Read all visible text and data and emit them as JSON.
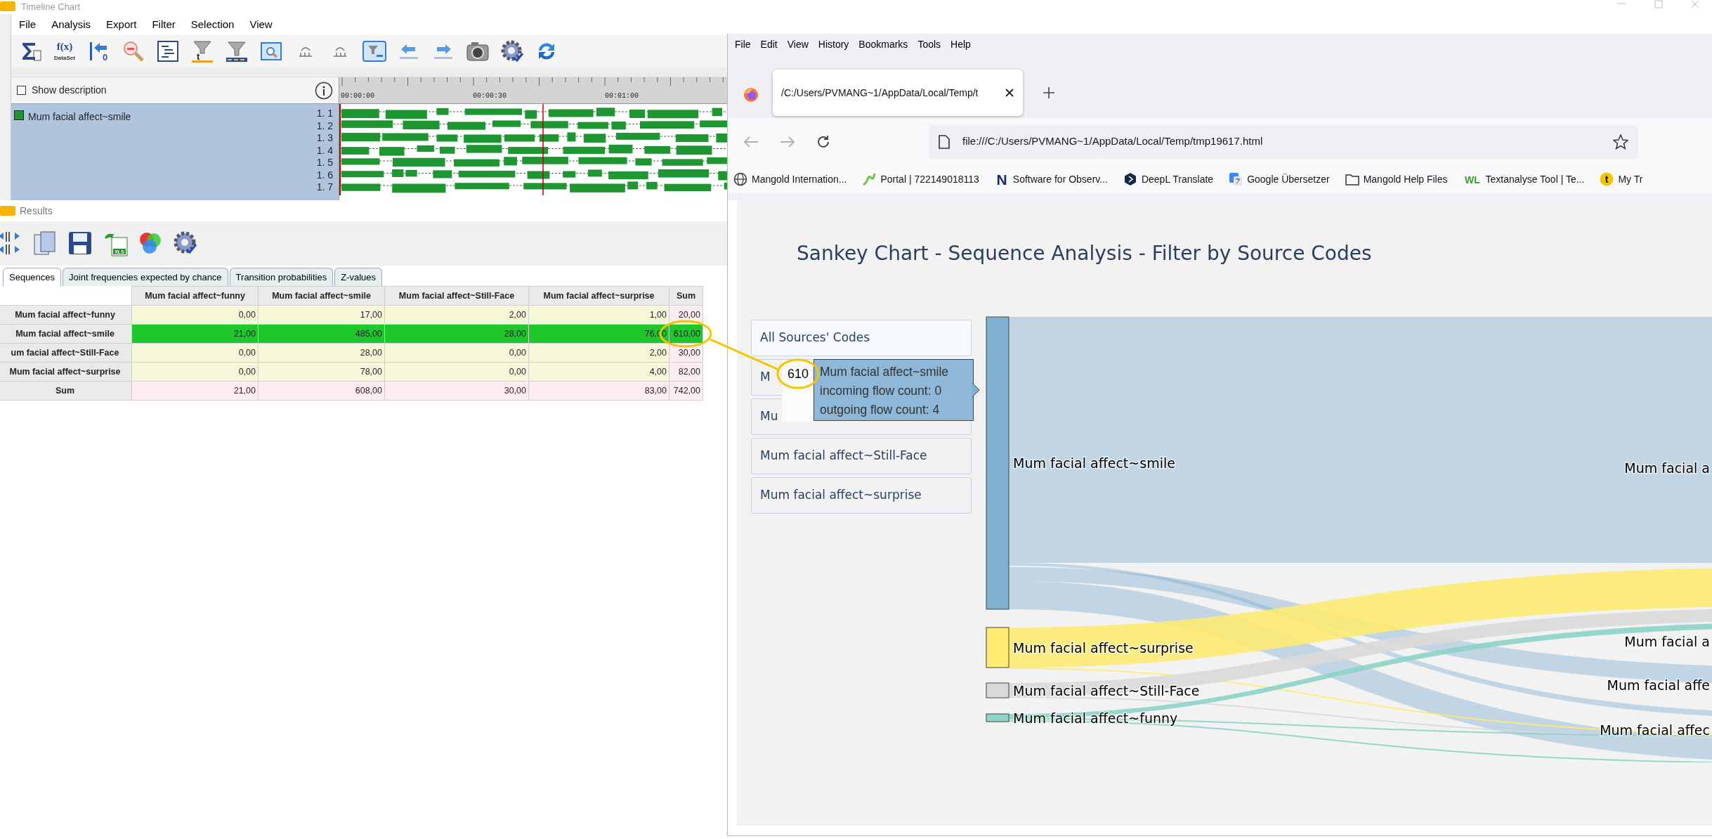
{
  "timeline_window": {
    "title": "Timeline Chart",
    "menu": [
      "File",
      "Analysis",
      "Export",
      "Filter",
      "Selection",
      "View"
    ],
    "toolbar": [
      {
        "kind": "sigma"
      },
      {
        "kind": "fx",
        "text": "f(x)",
        "subtext": "DataSet"
      },
      {
        "kind": "goto_start",
        "text": "0"
      },
      {
        "kind": "zoom_out"
      },
      {
        "kind": "outline"
      },
      {
        "kind": "filter_t",
        "text": "t"
      },
      {
        "kind": "filter_bar"
      },
      {
        "kind": "search"
      },
      {
        "kind": "step_back"
      },
      {
        "kind": "step_forward"
      },
      {
        "kind": "filter_window"
      },
      {
        "kind": "arrow_left"
      },
      {
        "kind": "arrow_right"
      },
      {
        "kind": "camera"
      },
      {
        "kind": "gear"
      },
      {
        "kind": "refresh"
      }
    ],
    "show_description": {
      "label": "Show description",
      "checked": false
    },
    "code": {
      "label": "Mum facial affect~smile",
      "color": "#1e9632"
    },
    "rows": [
      "1. 1",
      "1. 2",
      "1. 3",
      "1. 4",
      "1. 5",
      "1. 6",
      "1. 7"
    ],
    "time_labels": [
      "00:00:00",
      "00:00:30",
      "00:01:00"
    ]
  },
  "results_window": {
    "title": "Results",
    "toolbar": [
      {
        "kind": "transpose"
      },
      {
        "kind": "copy"
      },
      {
        "kind": "save"
      },
      {
        "kind": "excel",
        "text": "XLS"
      },
      {
        "kind": "circles"
      },
      {
        "kind": "settings"
      }
    ],
    "tabs": [
      {
        "label": "Sequences",
        "selected": true
      },
      {
        "label": "Joint frequencies expected by chance",
        "selected": false
      },
      {
        "label": "Transition probabilities",
        "selected": false
      },
      {
        "label": "Z-values",
        "selected": false
      }
    ],
    "table": {
      "columns": [
        "Mum facial affect~funny",
        "Mum facial affect~smile",
        "Mum facial affect~Still-Face",
        "Mum facial affect~surprise",
        "Sum"
      ],
      "rows": [
        {
          "label": "Mum facial affect~funny",
          "kind": "code",
          "selected": false,
          "cells": [
            "0,00",
            "17,00",
            "2,00",
            "1,00",
            "20,00"
          ]
        },
        {
          "label": "Mum facial affect~smile",
          "kind": "code",
          "selected": true,
          "cells": [
            "21,00",
            "485,00",
            "28,00",
            "76,00",
            "610,00"
          ]
        },
        {
          "label": "um facial affect~Still-Face",
          "kind": "code",
          "selected": false,
          "cells": [
            "0,00",
            "28,00",
            "0,00",
            "2,00",
            "30,00"
          ]
        },
        {
          "label": "Mum facial affect~surprise",
          "kind": "code",
          "selected": false,
          "cells": [
            "0,00",
            "78,00",
            "0,00",
            "4,00",
            "82,00"
          ]
        },
        {
          "label": "Sum",
          "kind": "sum",
          "selected": false,
          "cells": [
            "21,00",
            "608,00",
            "30,00",
            "83,00",
            "742,00"
          ]
        }
      ]
    }
  },
  "browser": {
    "menu": [
      "File",
      "Edit",
      "View",
      "History",
      "Bookmarks",
      "Tools",
      "Help"
    ],
    "tab": {
      "title": "/C:/Users/PVMANG~1/AppData/Local/Temp/t"
    },
    "back": {
      "disabled": true
    },
    "forward": {
      "disabled": true
    },
    "url": "file:///C:/Users/PVMANG~1/AppData/Local/Temp/tmp19617.html",
    "bookmarks": [
      {
        "kind": "globe",
        "label": "Mangold Internation..."
      },
      {
        "kind": "portal",
        "label": "Portal | 722149018113"
      },
      {
        "kind": "letter",
        "icon_text": "N",
        "label": "Software for Observ..."
      },
      {
        "kind": "deepl",
        "label": "DeepL Translate"
      },
      {
        "kind": "translate",
        "label": "Google Übersetzer"
      },
      {
        "kind": "folder",
        "label": "Mangold Help Files"
      },
      {
        "kind": "wl",
        "icon_text": "WL",
        "label": "Textanalyse Tool | Te..."
      },
      {
        "kind": "badge",
        "icon_text": "t",
        "label": "My Tr"
      }
    ]
  },
  "page": {
    "title": "Sankey Chart - Sequence Analysis - Filter by Source Codes",
    "filter_buttons": [
      {
        "label": "All Sources' Codes",
        "selected": true
      },
      {
        "label": "M",
        "selected": false
      },
      {
        "label": "Mu",
        "selected": false
      },
      {
        "label": "Mum facial affect~Still-Face",
        "selected": false
      },
      {
        "label": "Mum facial affect~surprise",
        "selected": false
      }
    ],
    "sankey": {
      "source_nodes": [
        {
          "label": "Mum facial affect~smile",
          "color": "#7fafd1"
        },
        {
          "label": "Mum facial affect~surprise",
          "color": "#fdeb72"
        },
        {
          "label": "Mum facial affect~Still-Face",
          "color": "#d9d9d9"
        },
        {
          "label": "Mum facial affect~funny",
          "color": "#8dd3c7"
        }
      ],
      "target_labels": [
        "Mum facial a",
        "Mum facial a",
        "Mum facial affe",
        "Mum facial affec"
      ]
    },
    "tooltip": {
      "value": "610",
      "lines": [
        "Mum facial affect~smile",
        "incoming flow count: 0",
        "outgoing flow count: 4"
      ]
    }
  }
}
